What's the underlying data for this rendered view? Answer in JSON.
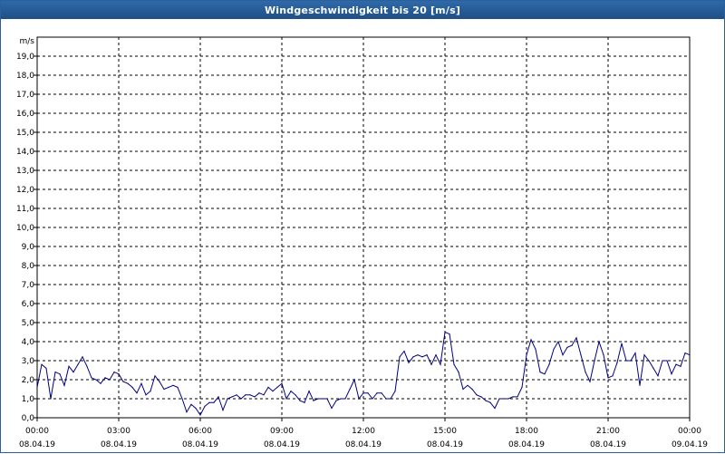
{
  "colors": {
    "accent": "#2f6aa8",
    "series": "#000080",
    "grid": "#000000"
  },
  "chart_data": {
    "type": "line",
    "title": "Windgeschwindigkeit bis 20 [m/s]",
    "ylabel": "m/s",
    "xlabel": "",
    "ylim": [
      0,
      20
    ],
    "xlim_hours": [
      0,
      24
    ],
    "grid": true,
    "y_ticks": [
      "0,0",
      "1,0",
      "2,0",
      "3,0",
      "4,0",
      "5,0",
      "6,0",
      "7,0",
      "8,0",
      "9,0",
      "10,0",
      "11,0",
      "12,0",
      "13,0",
      "14,0",
      "15,0",
      "16,0",
      "17,0",
      "18,0",
      "19,0"
    ],
    "x_ticks": [
      {
        "time": "00:00",
        "date": "08.04.19"
      },
      {
        "time": "03:00",
        "date": "08.04.19"
      },
      {
        "time": "06:00",
        "date": "08.04.19"
      },
      {
        "time": "09:00",
        "date": "08.04.19"
      },
      {
        "time": "12:00",
        "date": "08.04.19"
      },
      {
        "time": "15:00",
        "date": "08.04.19"
      },
      {
        "time": "18:00",
        "date": "08.04.19"
      },
      {
        "time": "21:00",
        "date": "08.04.19"
      },
      {
        "time": "00:00",
        "date": "09.04.19"
      }
    ],
    "series": [
      {
        "x_start": "08.04.19 00:00",
        "x_step_minutes": 10,
        "values": [
          1.6,
          2.8,
          2.6,
          1.0,
          2.4,
          2.3,
          1.7,
          2.7,
          2.4,
          2.8,
          3.2,
          2.7,
          2.1,
          2.0,
          1.8,
          2.1,
          2.0,
          2.4,
          2.3,
          1.9,
          1.8,
          1.6,
          1.3,
          1.8,
          1.2,
          1.4,
          2.2,
          1.9,
          1.5,
          1.6,
          1.7,
          1.6,
          1.0,
          0.3,
          0.7,
          0.5,
          0.15,
          0.6,
          0.8,
          0.8,
          1.1,
          0.4,
          1.0,
          1.1,
          1.2,
          1.0,
          1.2,
          1.2,
          1.1,
          1.3,
          1.2,
          1.6,
          1.4,
          1.6,
          1.8,
          1.0,
          1.4,
          1.2,
          0.9,
          0.8,
          1.4,
          0.9,
          1.0,
          1.0,
          1.0,
          0.5,
          0.9,
          1.0,
          1.0,
          1.5,
          2.0,
          1.0,
          1.3,
          1.3,
          1.0,
          1.3,
          1.3,
          1.0,
          1.0,
          1.4,
          3.2,
          3.5,
          2.9,
          3.2,
          3.3,
          3.2,
          3.3,
          2.8,
          3.3,
          2.8,
          4.5,
          4.4,
          2.8,
          2.4,
          1.5,
          1.7,
          1.5,
          1.2,
          1.1,
          0.9,
          0.8,
          0.5,
          1.0,
          1.0,
          1.0,
          1.1,
          1.1,
          1.6,
          3.3,
          4.1,
          3.6,
          2.4,
          2.3,
          2.8,
          3.6,
          4.0,
          3.3,
          3.7,
          3.8,
          4.2,
          3.3,
          2.4,
          1.9,
          3.0,
          4.0,
          3.3,
          2.1,
          2.2,
          2.9,
          3.9,
          3.0,
          3.0,
          3.4,
          1.7,
          3.3,
          3.0,
          2.6,
          2.2,
          3.0,
          3.0,
          2.3,
          2.8,
          2.7,
          3.4,
          3.3
        ]
      }
    ]
  }
}
